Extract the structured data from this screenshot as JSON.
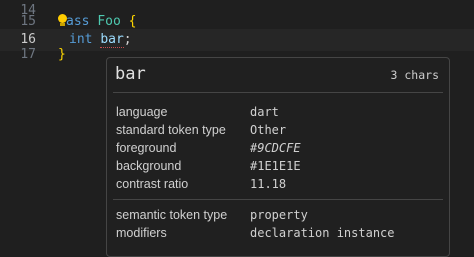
{
  "editor": {
    "lines": [
      {
        "number": "14"
      },
      {
        "number": "15",
        "parts": [
          "ass",
          "Foo",
          "{"
        ]
      },
      {
        "number": "16",
        "parts": [
          "int",
          "bar",
          ";"
        ]
      },
      {
        "number": "17",
        "parts": [
          "}"
        ]
      }
    ]
  },
  "hover": {
    "title": "bar",
    "char_count": "3 chars",
    "rows": [
      {
        "key": "language",
        "value": "dart"
      },
      {
        "key": "standard token type",
        "value": "Other"
      },
      {
        "key": "foreground",
        "value": "#9CDCFE"
      },
      {
        "key": "background",
        "value": "#1E1E1E"
      },
      {
        "key": "contrast ratio",
        "value": "11.18"
      },
      {
        "key": "semantic token type",
        "value": "property"
      },
      {
        "key": "modifiers",
        "value": "declaration instance"
      }
    ]
  },
  "colors": {
    "keyword": "#569cd6",
    "class": "#4ec9b0",
    "brace": "#ffd700",
    "variable": "#9cdcfe"
  }
}
